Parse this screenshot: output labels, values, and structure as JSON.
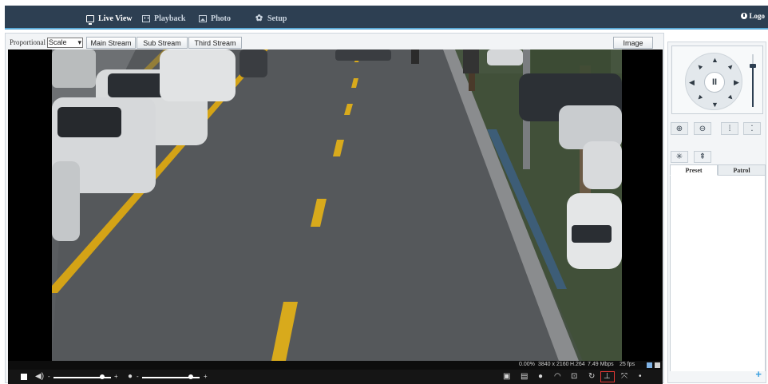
{
  "nav": {
    "items": [
      {
        "label": "Live View",
        "icon": "monitor-icon",
        "active": true
      },
      {
        "label": "Playback",
        "icon": "film-icon",
        "active": false
      },
      {
        "label": "Photo",
        "icon": "photo-icon",
        "active": false
      },
      {
        "label": "Setup",
        "icon": "gear-icon",
        "active": false
      }
    ],
    "logout_label": "Logo"
  },
  "toolbar": {
    "proportional_label": "Proportional",
    "scale_value": "Scale",
    "streams": [
      "Main Stream",
      "Sub Stream",
      "Third Stream"
    ],
    "image_label": "Image"
  },
  "status": {
    "loss": "0.00%",
    "resolution": "3840 x 2160",
    "codec": "H.264",
    "bitrate": "7.49 Mbps",
    "framerate": "25 fps"
  },
  "controls": {
    "volume_level": 0.85,
    "mic_level": 0.85,
    "selected_tool": "3d-positioning-icon",
    "accent": "#e53935"
  },
  "ptz": {
    "tabs": [
      "Preset",
      "Patrol"
    ],
    "active_tab": "Preset",
    "pause_glyph": "II",
    "add_glyph": "+"
  },
  "colors": {
    "nav_bg": "#2d3f52",
    "nav_accent": "#5aa9d6"
  }
}
